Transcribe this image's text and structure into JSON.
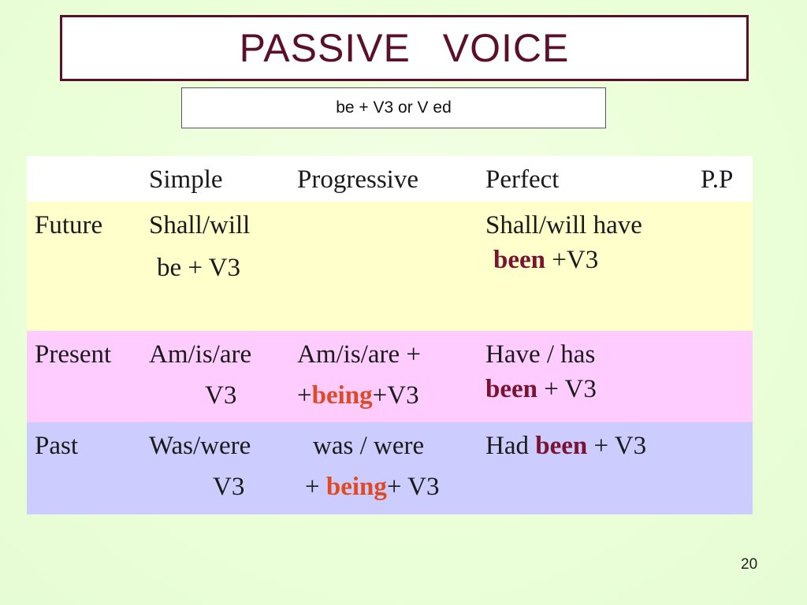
{
  "title": "PASSIVE   VOICE",
  "formula": "be + V3 or V ed",
  "colors": {
    "title_border": "#5a0f2a",
    "been": "#7b1230",
    "being": "#e04a22",
    "row_future": "#ffffcc",
    "row_present": "#ffccff",
    "row_past": "#ccccff",
    "background": "#ebffd9"
  },
  "table": {
    "headers": [
      "",
      "Simple",
      "Progressive",
      "Perfect",
      "P.P"
    ],
    "future": {
      "label": "Future",
      "simple": {
        "line1": "Shall/will",
        "line2": "be  +  V3"
      },
      "progressive": {
        "line1": "",
        "line2": ""
      },
      "perfect": {
        "line1": "Shall/will have",
        "line2_bold": "been",
        "line2_rest": " +V3"
      }
    },
    "present": {
      "label": "Present",
      "simple": {
        "line1": "Am/is/are",
        "line2": "V3"
      },
      "progressive": {
        "line1": "Am/is/are +",
        "line2_pre": "+",
        "line2_bold": "being",
        "line2_rest": "+V3"
      },
      "perfect": {
        "line1": "Have / has",
        "line2_bold": "been",
        "line2_rest": " + V3"
      }
    },
    "past": {
      "label": "Past",
      "simple": {
        "line1": "Was/were",
        "line2": "V3"
      },
      "progressive": {
        "line1": "was / were",
        "line2_pre": "+ ",
        "line2_bold": "being",
        "line2_rest": "+ V3"
      },
      "perfect": {
        "line1_pre": "Had ",
        "line1_bold": "been",
        "line1_rest": " + V3"
      }
    }
  },
  "page_number": "20"
}
